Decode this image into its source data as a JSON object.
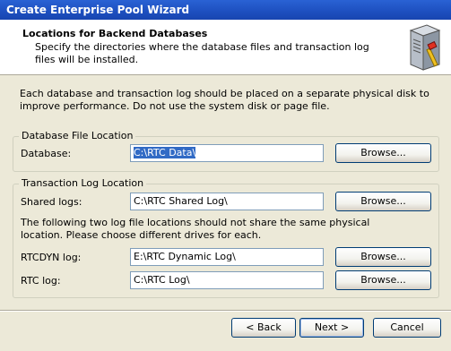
{
  "window": {
    "title": "Create Enterprise Pool Wizard"
  },
  "header": {
    "title": "Locations for Backend Databases",
    "subtitle": "Specify the directories where the database files and transaction log files will be installed.",
    "icon": "server-icon"
  },
  "intro": "Each database and transaction log should be placed on a separate physical disk to improve performance. Do not use the system disk or page file.",
  "database_group": {
    "legend": "Database File Location",
    "database_label": "Database:",
    "database_value": "C:\\RTC Data\\",
    "browse_label": "Browse..."
  },
  "log_group": {
    "legend": "Transaction Log Location",
    "shared_label": "Shared logs:",
    "shared_value": "C:\\RTC Shared Log\\",
    "note": "The following two log file locations should not share the same physical location. Please choose different drives for each.",
    "rtcdyn_label": "RTCDYN log:",
    "rtcdyn_value": "E:\\RTC Dynamic Log\\",
    "rtc_label": "RTC log:",
    "rtc_value": "C:\\RTC Log\\",
    "browse_label": "Browse..."
  },
  "footer": {
    "back_label": "< Back",
    "next_label": "Next >",
    "cancel_label": "Cancel"
  }
}
